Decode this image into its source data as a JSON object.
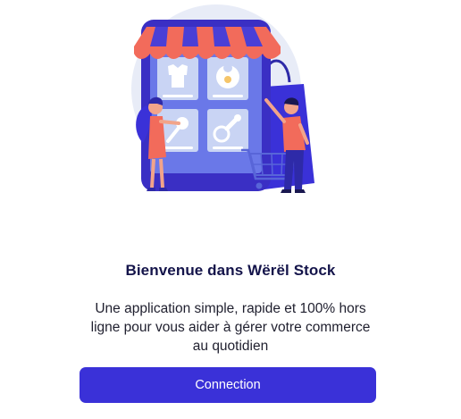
{
  "welcome": {
    "title": "Bienvenue dans Wërël Stock",
    "subtitle": "Une application simple, rapide et 100% hors ligne pour vous aider à gérer votre commerce au quotidien"
  },
  "actions": {
    "connect_label": "Connection"
  },
  "colors": {
    "primary": "#3a31d8",
    "title": "#14144a",
    "awning_red": "#f26b5b",
    "device_blue": "#3a2fc4"
  },
  "illustration": {
    "icon": "online-shop-illustration"
  }
}
